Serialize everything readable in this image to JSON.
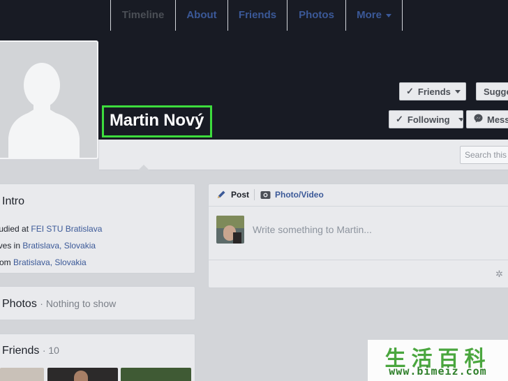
{
  "profile": {
    "name": "Martin Nový",
    "buttons": {
      "friends": "Friends",
      "suggest": "Sugge",
      "following": "Following",
      "message": "Mess"
    }
  },
  "nav": {
    "tabs": [
      "Timeline",
      "About",
      "Friends",
      "Photos",
      "More"
    ],
    "active": "Timeline",
    "search_placeholder": "Search this"
  },
  "intro": {
    "title": "Intro",
    "lines": [
      {
        "prefix": "tudied at ",
        "link": "FEI STU Bratislava"
      },
      {
        "prefix": "ives in ",
        "link": "Bratislava, Slovakia"
      },
      {
        "prefix": "rom ",
        "link": "Bratislava, Slovakia"
      }
    ]
  },
  "photos_card": {
    "title": "Photos",
    "note": "· Nothing to show"
  },
  "friends_card": {
    "title": "Friends",
    "count": "· 10"
  },
  "composer": {
    "post_label": "Post",
    "photo_video_label": "Photo/Video",
    "placeholder": "Write something to Martin..."
  },
  "watermark": {
    "chars": "生活百科",
    "url": "www.bimeiz.com"
  },
  "colors": {
    "cover": "#181b24",
    "link": "#3b5998",
    "highlight": "#3ddc3d",
    "background": "#d3d5d9"
  },
  "icons": [
    "check-icon",
    "messenger-icon",
    "pencil-icon",
    "camera-icon",
    "gear-icon"
  ]
}
